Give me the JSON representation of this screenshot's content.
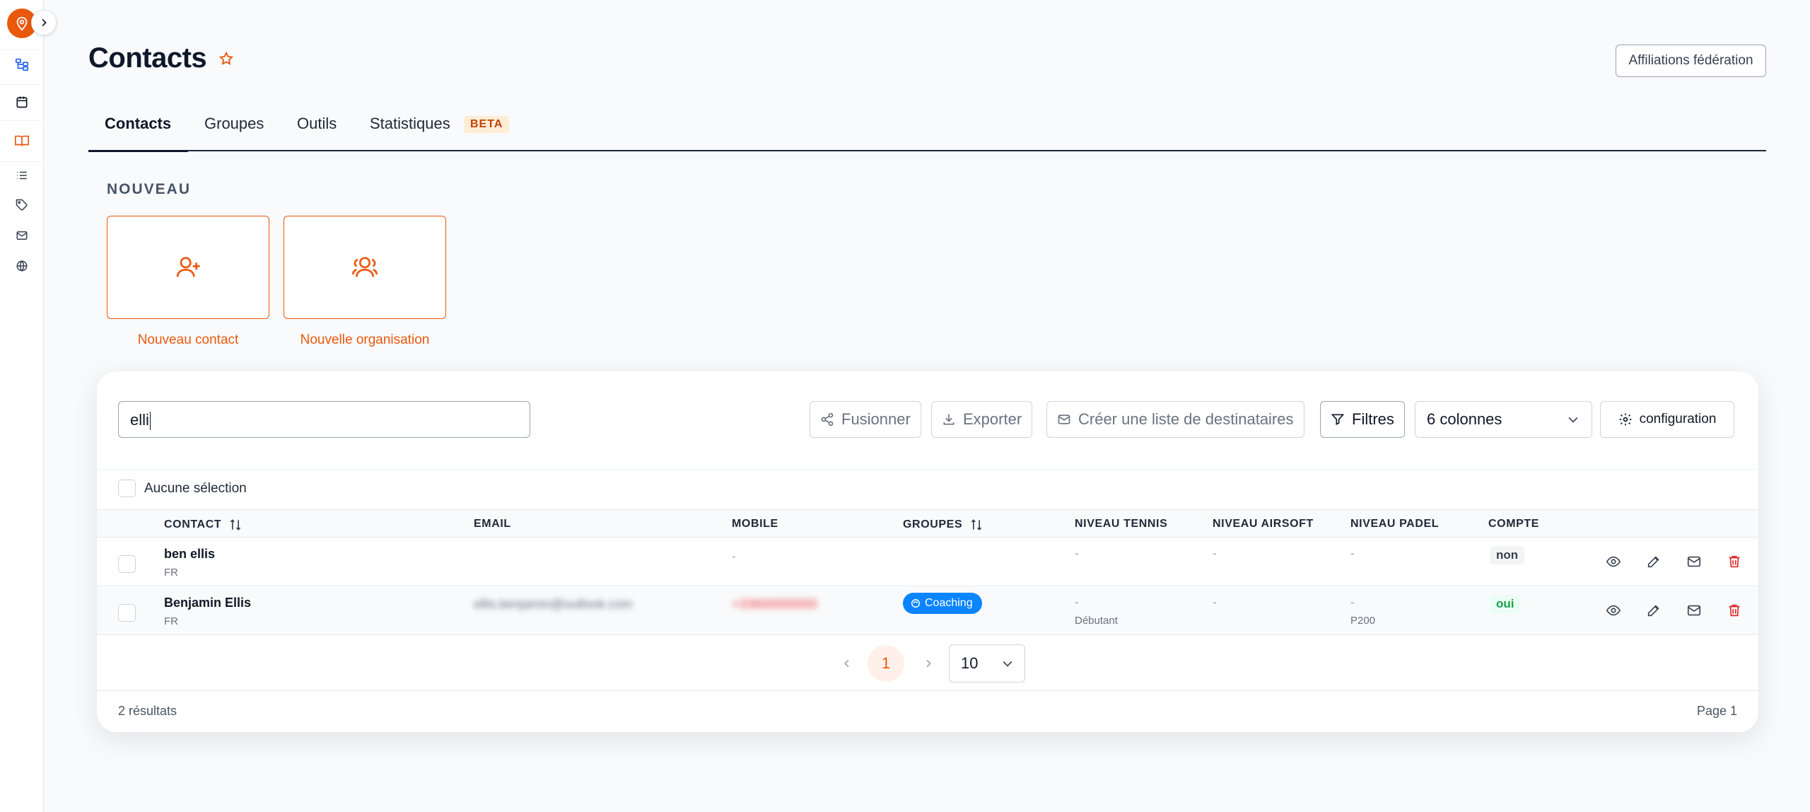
{
  "header": {
    "title": "Contacts",
    "affiliations_button": "Affiliations fédération"
  },
  "tabs": [
    {
      "label": "Contacts",
      "active": true
    },
    {
      "label": "Groupes"
    },
    {
      "label": "Outils"
    },
    {
      "label": "Statistiques",
      "badge": "BETA"
    }
  ],
  "new_section": {
    "label": "NOUVEAU",
    "new_contact": "Nouveau contact",
    "new_organisation": "Nouvelle organisation"
  },
  "toolbar": {
    "search_value": "elli",
    "merge": "Fusionner",
    "export": "Exporter",
    "create_list": "Créer une liste de destinataires",
    "filters": "Filtres",
    "columns": "6 colonnes",
    "configuration": "configuration"
  },
  "selection": {
    "label": "Aucune sélection"
  },
  "table": {
    "columns": [
      "CONTACT",
      "EMAIL",
      "MOBILE",
      "GROUPES",
      "NIVEAU TENNIS",
      "NIVEAU AIRSOFT",
      "NIVEAU PADEL",
      "COMPTE"
    ],
    "rows": [
      {
        "name": "ben ellis",
        "country": "FR",
        "email": "",
        "mobile": "-",
        "group": "",
        "tennis": "-",
        "tennis_sub": "",
        "airsoft": "-",
        "padel": "-",
        "padel_sub": "",
        "account": "non"
      },
      {
        "name": "Benjamin Ellis",
        "country": "FR",
        "email": "ellis.benjamin@outlook.com",
        "mobile": "+33600000000",
        "group": "Coaching",
        "tennis": "-",
        "tennis_sub": "Débutant",
        "airsoft": "-",
        "padel": "-",
        "padel_sub": "P200",
        "account": "oui"
      }
    ]
  },
  "pagination": {
    "current_page": "1",
    "page_size": "10",
    "results": "2 résultats",
    "page_label": "Page 1"
  },
  "colors": {
    "accent": "#ea580c",
    "group_badge": "#0a84ff",
    "delete": "#dc2626",
    "account_yes": "#16a34a"
  },
  "icons": {
    "sidebar": [
      "tree-icon",
      "calendar-icon",
      "book-icon",
      "list-icon",
      "tag-icon",
      "mail-icon",
      "globe-icon"
    ]
  }
}
